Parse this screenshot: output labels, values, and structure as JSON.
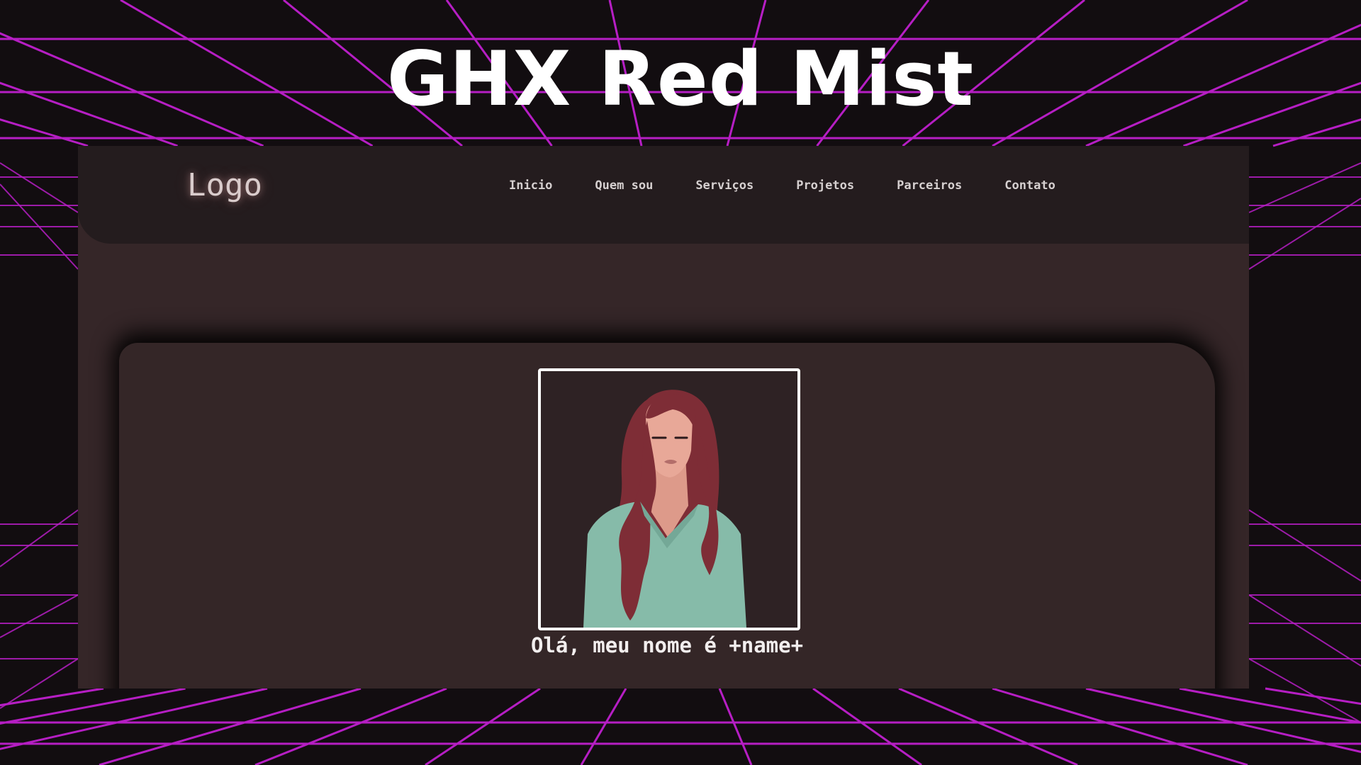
{
  "banner": {
    "title": "GHX Red Mist"
  },
  "site": {
    "logo": "Logo",
    "nav": [
      "Inicio",
      "Quem sou",
      "Serviços",
      "Projetos",
      "Parceiros",
      "Contato"
    ],
    "hero": {
      "greeting": "Olá, meu nome é +name+"
    }
  },
  "colors": {
    "grid_line": "#b61ec4",
    "background": "#120d10",
    "site_body": "#352628",
    "site_header": "#241c1e",
    "hair": "#7e2d36",
    "sweater": "#86bba9",
    "skin": "#e8a898"
  },
  "icons": {
    "portrait": "woman-illustration"
  }
}
